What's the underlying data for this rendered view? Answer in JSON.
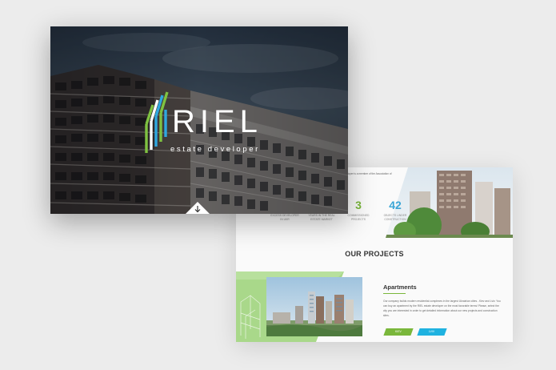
{
  "hero": {
    "brand": "RIEL",
    "tagline": "estate developer",
    "scroll_icon": "arrow-down-icon"
  },
  "about": {
    "blurb_line1": "...developer is a member of the Association of",
    "blurb_line2": "..."
  },
  "stats": [
    {
      "number": "",
      "label_line1": "EXCESS DEVELOPER",
      "label_line2": "IN UKR",
      "color": "#3aa6d6"
    },
    {
      "number": "",
      "label_line1": "YEARS IN THE REAL",
      "label_line2": "ESTATE MARKET",
      "color": "#3aa6d6"
    },
    {
      "number": "3",
      "label_line1": "COMMISSIONED",
      "label_line2": "PROJECTS",
      "color": "#7ab73b"
    },
    {
      "number": "42",
      "label_line1": "OBJECTS UNDER",
      "label_line2": "CONSTRUCTION",
      "color": "#3aa6d6"
    }
  ],
  "projects": {
    "section_title": "OUR PROJECTS",
    "title": "Apartments",
    "description": "Our company builds modern residential complexes in the largest Ukrainian cities - Kiev and Lviv. You can buy an apartment by the RIEL estate developer on the most favorable terms! Please, select the city you are interested in order to get detailed information about our new projects and construction sites.",
    "more_label": "KIEV",
    "view_label": "LVIV"
  },
  "colors": {
    "green": "#7ab73b",
    "blue": "#1fb2e0",
    "background": "#ececec"
  }
}
